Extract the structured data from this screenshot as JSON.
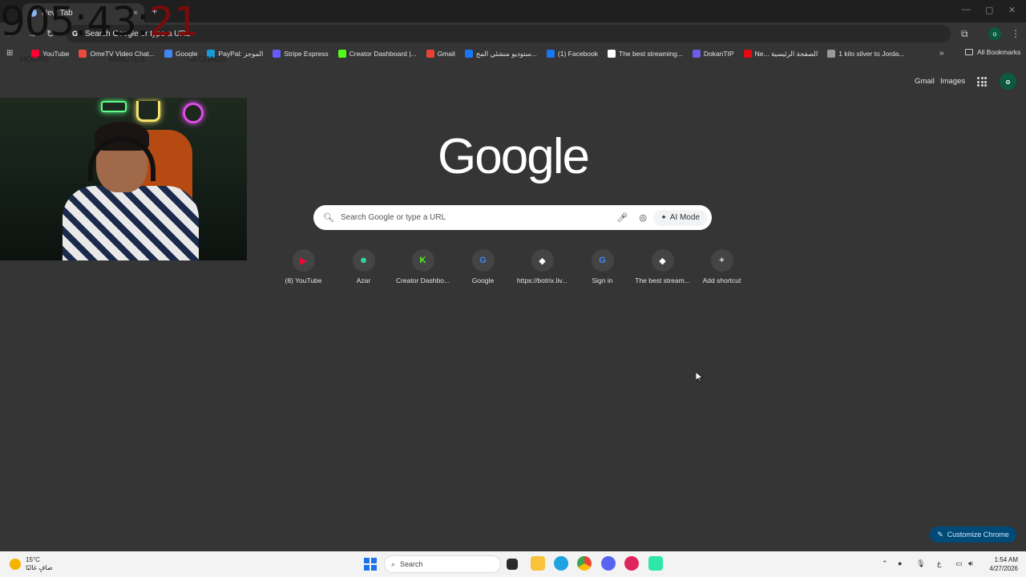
{
  "browser": {
    "tab_title": "New Tab",
    "tab_close": "×",
    "new_tab": "+",
    "omnibox_text": "Search Google or type a URL",
    "profile_initial": "o"
  },
  "bookmarks": [
    {
      "label": "YouTube",
      "color": "#ff0033"
    },
    {
      "label": "OmeTV Video Chat...",
      "color": "#e74c3c"
    },
    {
      "label": "Google",
      "color": "#4285f4"
    },
    {
      "label": "PayPal: الموجز",
      "color": "#179bd7"
    },
    {
      "label": "Stripe Express",
      "color": "#635bff"
    },
    {
      "label": "Creator Dashboard |...",
      "color": "#53fc18"
    },
    {
      "label": "Gmail",
      "color": "#ea4335"
    },
    {
      "label": "ستوديو منشئي المح...",
      "color": "#1877f2"
    },
    {
      "label": "(1) Facebook",
      "color": "#1877f2"
    },
    {
      "label": "The best streaming...",
      "color": "#ffffff"
    },
    {
      "label": "DokanTIP",
      "color": "#6c5ce7"
    },
    {
      "label": "Ne... الصفحة الرئيسية",
      "color": "#e50914"
    },
    {
      "label": "1 kilo silver to Jorda...",
      "color": "#999999"
    }
  ],
  "all_bookmarks": "All Bookmarks",
  "timer": {
    "hours": "905",
    "minutes": "43",
    "seconds": "21",
    "sep": ":",
    "label_hours": "HOURS",
    "label_minutes": "MINUTES",
    "label_seconds": "SECONDS"
  },
  "header_links": {
    "gmail": "Gmail",
    "images": "Images",
    "avatar_initial": "o"
  },
  "logo_text": "Google",
  "search": {
    "placeholder": "Search Google or type a URL",
    "ai_mode": "AI Mode"
  },
  "shortcuts": [
    {
      "label": "(8) YouTube",
      "glyph": "▶",
      "color": "#ff0033"
    },
    {
      "label": "Azar",
      "glyph": "☻",
      "color": "#2ee6a6"
    },
    {
      "label": "Creator Dashbo...",
      "glyph": "K",
      "color": "#53fc18"
    },
    {
      "label": "Google",
      "glyph": "G",
      "color": "#4285f4"
    },
    {
      "label": "https://botrix.liv...",
      "glyph": "◆",
      "color": "#ffffff"
    },
    {
      "label": "Sign in",
      "glyph": "G",
      "color": "#4285f4"
    },
    {
      "label": "The best stream...",
      "glyph": "◆",
      "color": "#ffffff"
    },
    {
      "label": "Add shortcut",
      "glyph": "+",
      "color": "#e3e3e3"
    }
  ],
  "customize_label": "Customize Chrome",
  "taskbar": {
    "temperature": "15°C",
    "weather_text": "صافٍ غالبًا",
    "search_label": "Search",
    "time": "1:54 AM",
    "date": "4/27/2026",
    "ime": "ع"
  }
}
